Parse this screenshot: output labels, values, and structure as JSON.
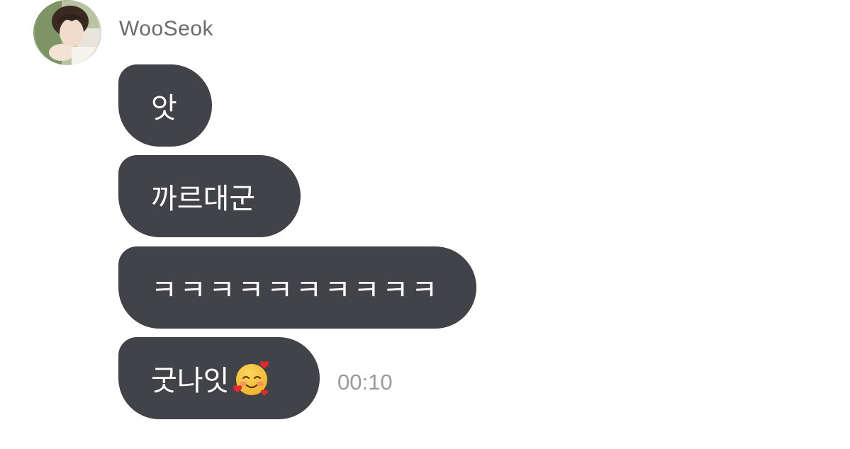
{
  "sender": {
    "name": "WooSeok",
    "avatar_icon": "profile-photo"
  },
  "messages": [
    {
      "text": "앗"
    },
    {
      "text": "까르대군"
    },
    {
      "text": "ㅋㅋㅋㅋㅋㅋㅋㅋㅋㅋ"
    },
    {
      "text": "굿나잇",
      "emoji": "smiling-face-with-hearts-icon",
      "time": "00:10"
    }
  ],
  "colors": {
    "bubble": "#424349",
    "bubble_text": "#ffffff",
    "name_text": "#6b6b6b",
    "time_text": "#9a9a9a",
    "background": "#ffffff"
  }
}
